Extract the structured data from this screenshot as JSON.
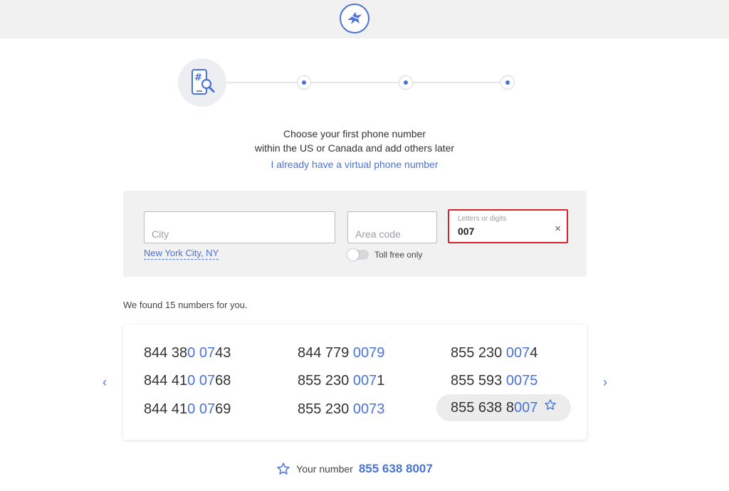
{
  "header": {
    "logo_icon": "bird-logo-icon"
  },
  "stepper": {
    "steps": 4,
    "active_step": 1,
    "main_icon": "phone-search-icon"
  },
  "intro": {
    "line1": "Choose your first phone number",
    "line2": "within the US or Canada and add others later",
    "link": "I already have a virtual phone number"
  },
  "filters": {
    "city_placeholder": "City",
    "area_placeholder": "Area code",
    "letters_label": "Letters or digits",
    "letters_value": "007",
    "clear_symbol": "×",
    "city_link": "New York City, NY",
    "toll_free_label": "Toll free only",
    "toll_free_enabled": false
  },
  "results": {
    "summary": "We found 15 numbers for you.",
    "numbers": [
      {
        "pre": "844 38",
        "hl": "0 07",
        "post": "43"
      },
      {
        "pre": "844 41",
        "hl": "0 07",
        "post": "68"
      },
      {
        "pre": "844 41",
        "hl": "0 07",
        "post": "69"
      },
      {
        "pre": "844 779 ",
        "hl": "0079",
        "post": ""
      },
      {
        "pre": "855 230 ",
        "hl": "007",
        "post": "1"
      },
      {
        "pre": "855 230 ",
        "hl": "0073",
        "post": ""
      },
      {
        "pre": "855 230 ",
        "hl": "007",
        "post": "4"
      },
      {
        "pre": "855 593 ",
        "hl": "0075",
        "post": ""
      },
      {
        "pre": "855 638 8",
        "hl": "007",
        "post": ""
      }
    ],
    "selected_index": 8,
    "prev_arrow": "‹",
    "next_arrow": "›"
  },
  "your_number": {
    "label": "Your number",
    "value": "855 638 8007"
  },
  "colors": {
    "accent": "#4a73d8",
    "error": "#d8232a",
    "panel": "#f1f1f1"
  }
}
